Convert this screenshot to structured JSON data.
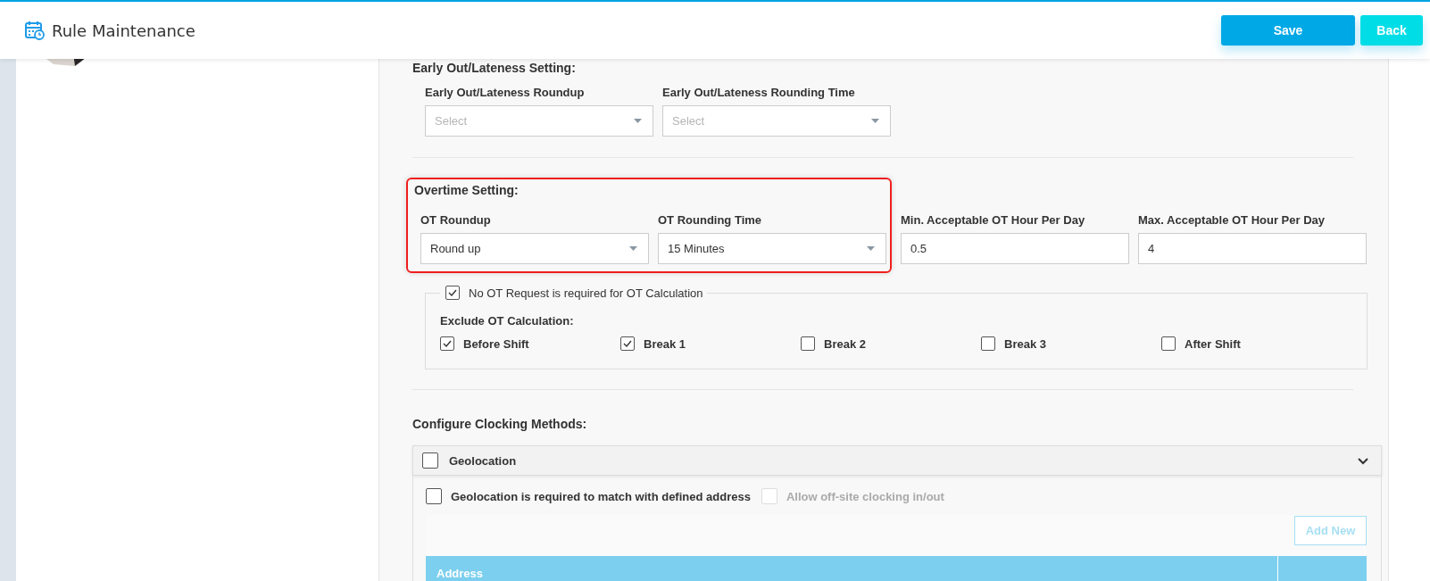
{
  "header": {
    "title": "Rule Maintenance",
    "buttons": [
      {
        "label": "Save",
        "kind": "primary"
      },
      {
        "label": "Back",
        "kind": "secondary"
      }
    ]
  },
  "early_out": {
    "title": "Early Out/Lateness Setting:",
    "fields": [
      {
        "label": "Early Out/Lateness Roundup",
        "placeholder": "Select",
        "kind": "select"
      },
      {
        "label": "Early Out/Lateness Rounding Time",
        "placeholder": "Select",
        "kind": "select"
      }
    ]
  },
  "overtime": {
    "title": "Overtime Setting:",
    "highlighted": true,
    "fields": [
      {
        "label": "OT Roundup",
        "value": "Round up",
        "kind": "select"
      },
      {
        "label": "OT Rounding Time",
        "value": "15 Minutes",
        "kind": "select"
      },
      {
        "label": "Min. Acceptable OT Hour Per Day",
        "value": "0.5",
        "kind": "input"
      },
      {
        "label": "Max. Acceptable OT Hour Per Day",
        "value": "4",
        "kind": "input"
      }
    ],
    "no_ot_request": {
      "label": "No OT Request is required for OT Calculation",
      "checked": true
    },
    "exclude": {
      "title": "Exclude OT Calculation:",
      "options": [
        {
          "label": "Before Shift",
          "checked": true
        },
        {
          "label": "Break 1",
          "checked": true
        },
        {
          "label": "Break 2",
          "checked": false
        },
        {
          "label": "Break 3",
          "checked": false
        },
        {
          "label": "After Shift",
          "checked": false
        }
      ]
    }
  },
  "clocking": {
    "title": "Configure Clocking Methods:",
    "methods": [
      {
        "label": "Geolocation",
        "checked": false,
        "expanded": true,
        "options": [
          {
            "label": "Geolocation is required to match with defined address",
            "checked": false,
            "disabled": false
          },
          {
            "label": "Allow off-site clocking in/out",
            "checked": false,
            "disabled": true
          }
        ],
        "add_button": {
          "label": "Add New",
          "disabled": true
        },
        "table": {
          "columns": [
            "Address"
          ]
        }
      }
    ]
  }
}
